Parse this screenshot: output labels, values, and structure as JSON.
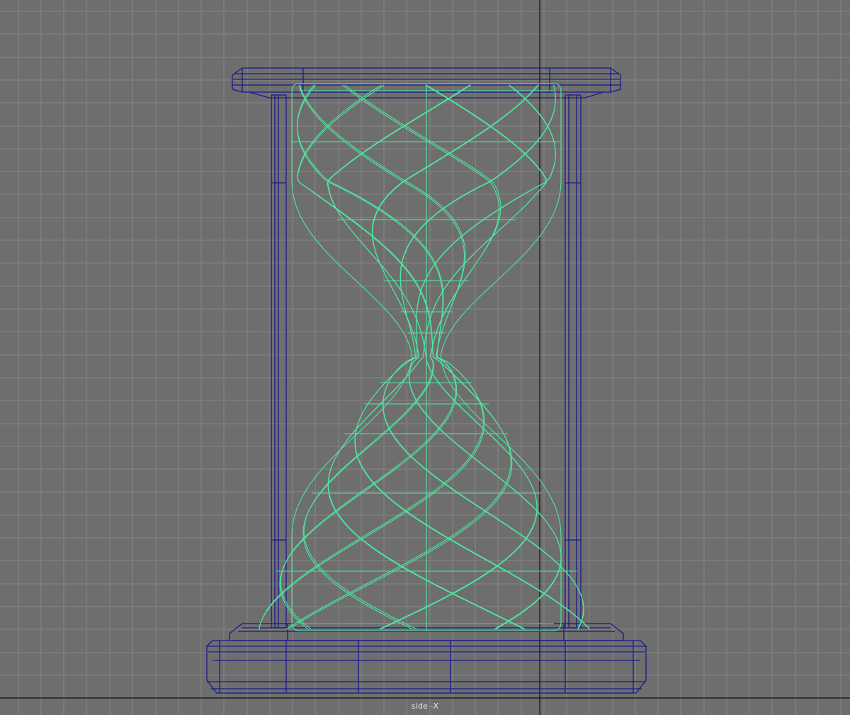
{
  "viewport": {
    "camera": "side",
    "camera_label": "side -X",
    "background_color": "#6e6e6e",
    "grid_color": "#858585",
    "axis_color": "#111111"
  },
  "model": {
    "name": "hourglass",
    "frame_wire_color": "#1a1a8c",
    "glass_wire_color": "#4de6a0",
    "state": "glass selected"
  }
}
